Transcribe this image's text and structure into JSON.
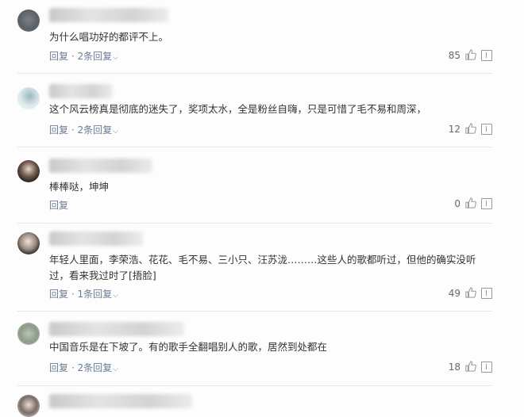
{
  "comments": [
    {
      "text": "为什么唱功好的都评不上。",
      "reply_label": "回复",
      "separator": " · ",
      "replies_label": "2条回复",
      "likes": "85"
    },
    {
      "text": "这个风云榜真是彻底的迷失了，奖项太水，全是粉丝自嗨，只是可惜了毛不易和周深，",
      "reply_label": "回复",
      "separator": " · ",
      "replies_label": "2条回复",
      "likes": "12"
    },
    {
      "text": "棒棒哒，坤坤",
      "reply_label": "回复",
      "likes": "0"
    },
    {
      "text": "年轻人里面，李荣浩、花花、毛不易、三小只、汪苏泷………这些人的歌都听过，但他的确实没听过，看来我过时了[捂脸]",
      "reply_label": "回复",
      "separator": " · ",
      "replies_label": "1条回复",
      "likes": "49"
    },
    {
      "text": "中国音乐是在下坡了。有的歌手全翻唱别人的歌，居然到处都在",
      "reply_label": "回复",
      "separator": " · ",
      "replies_label": "2条回复",
      "likes": "18"
    }
  ],
  "icons": {
    "like": "thumbs-up-icon",
    "report": "report-icon"
  },
  "colors": {
    "action_link": "#6a7c96",
    "text": "#333333",
    "divider": "#e6e6e6"
  }
}
